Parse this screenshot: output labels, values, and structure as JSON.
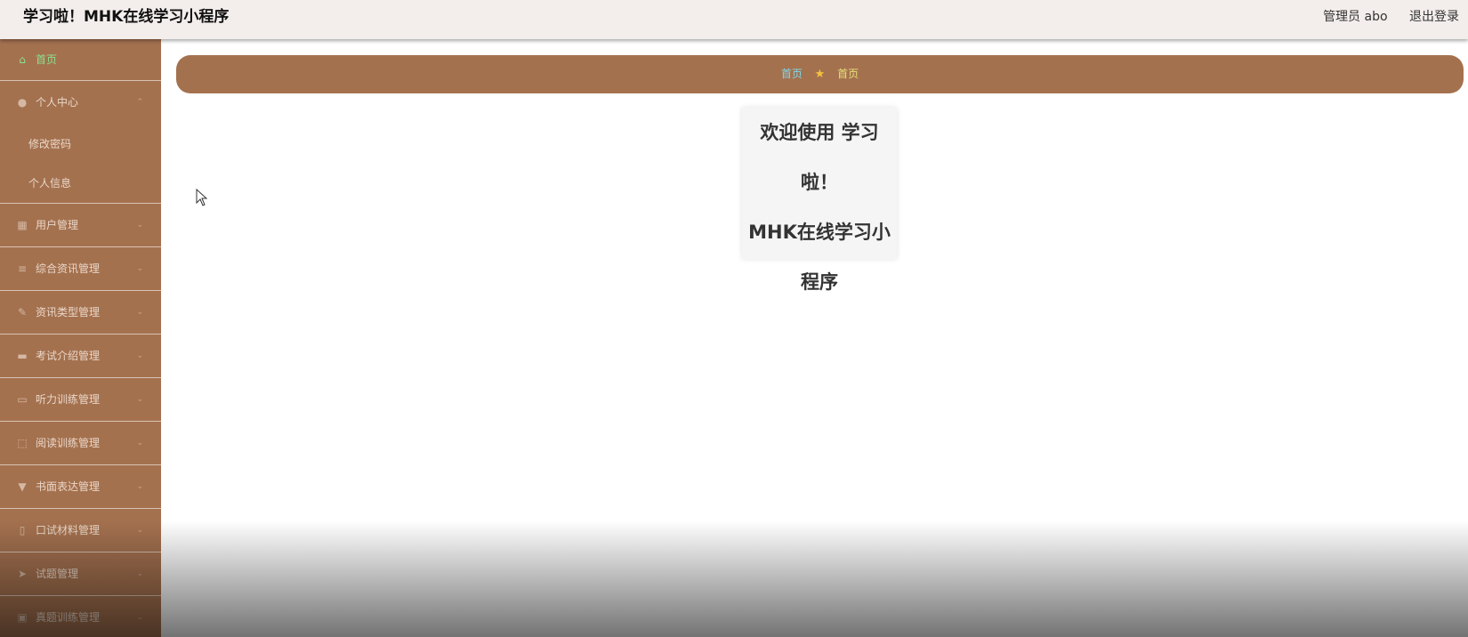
{
  "header": {
    "title": "学习啦！MHK在线学习小程序",
    "user": "管理员 abo",
    "logout": "退出登录"
  },
  "sidebar": {
    "home": {
      "label": "首页",
      "icon": "home-icon"
    },
    "personal": {
      "label": "个人中心",
      "icon": "user-icon",
      "children": [
        "修改密码",
        "个人信息"
      ]
    },
    "items": [
      {
        "label": "用户管理",
        "icon": "grid-icon"
      },
      {
        "label": "综合资讯管理",
        "icon": "list-icon"
      },
      {
        "label": "资讯类型管理",
        "icon": "edit-icon"
      },
      {
        "label": "考试介绍管理",
        "icon": "cup-icon"
      },
      {
        "label": "听力训练管理",
        "icon": "chat-icon"
      },
      {
        "label": "阅读训练管理",
        "icon": "frame-icon"
      },
      {
        "label": "书面表达管理",
        "icon": "brush-icon"
      },
      {
        "label": "口试材料管理",
        "icon": "mic-icon"
      },
      {
        "label": "试题管理",
        "icon": "send-icon"
      },
      {
        "label": "真题训练管理",
        "icon": "briefcase-icon"
      }
    ]
  },
  "breadcrumb": {
    "first": "首页",
    "second": "首页"
  },
  "welcome": {
    "line1": "欢迎使用 学习啦！",
    "line2": "MHK在线学习小",
    "line3": "程序"
  },
  "colors": {
    "sidebar": "#a4714f",
    "active": "#8de08d",
    "crumb_link": "#7fd9e8",
    "crumb_current": "#e8e07a"
  }
}
